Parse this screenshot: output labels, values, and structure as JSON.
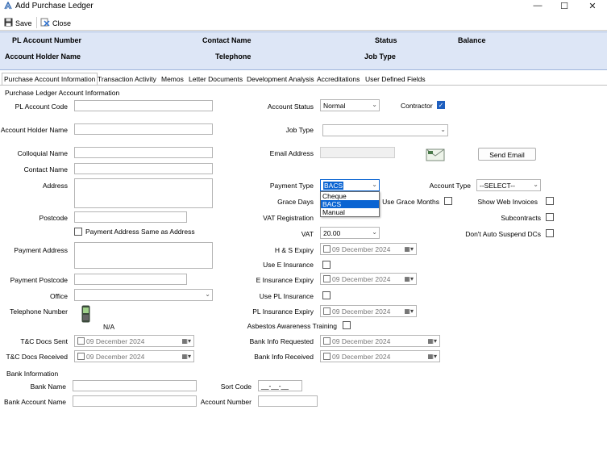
{
  "window": {
    "title": "Add Purchase Ledger",
    "controls": {
      "minimize": "—",
      "maximize": "☐",
      "close": "✕"
    }
  },
  "toolbar": {
    "save_label": "Save",
    "close_label": "Close"
  },
  "header": {
    "pl_account_number": "PL Account Number",
    "contact_name": "Contact Name",
    "status": "Status",
    "balance": "Balance",
    "account_holder_name": "Account Holder Name",
    "telephone": "Telephone",
    "job_type": "Job Type"
  },
  "tabs": [
    "Purchase Account Information",
    "Transaction Activity",
    "Memos",
    "Letter Documents",
    "Development Analysis",
    "Accreditations",
    "User Defined Fields"
  ],
  "section_title": "Purchase Ledger Account Information",
  "left": {
    "pl_account_code": "PL Account Code",
    "account_holder_name": "Account Holder Name",
    "colloquial_name": "Colloquial Name",
    "contact_name": "Contact Name",
    "address": "Address",
    "postcode": "Postcode",
    "payment_same_as_address": "Payment Address Same as Address",
    "payment_address": "Payment Address",
    "payment_postcode": "Payment Postcode",
    "office": "Office",
    "telephone_number": "Telephone Number",
    "telephone_value": "N/A",
    "tc_docs_sent": "T&C Docs Sent",
    "tc_docs_sent_value": "09 December 2024",
    "tc_docs_received": "T&C Docs Received",
    "tc_docs_received_value": "09 December 2024"
  },
  "middle": {
    "account_status": "Account Status",
    "account_status_value": "Normal",
    "job_type": "Job Type",
    "email_address": "Email Address",
    "payment_type": "Payment Type",
    "payment_type_value": "BACS",
    "payment_type_options": [
      "Cheque",
      "BACS",
      "Manual"
    ],
    "grace_days": "Grace Days",
    "vat_registration": "VAT Registration",
    "vat": "VAT",
    "vat_value": "20.00",
    "hs_expiry": "H & S Expiry",
    "hs_expiry_value": "09 December 2024",
    "use_e_insurance": "Use E Insurance",
    "e_insurance_expiry": "E Insurance Expiry",
    "e_insurance_expiry_value": "09 December 2024",
    "use_pl_insurance": "Use PL Insurance",
    "pl_insurance_expiry": "PL Insurance Expiry",
    "pl_insurance_expiry_value": "09 December 2024",
    "asbestos_training": "Asbestos Awareness Training",
    "bank_info_requested": "Bank Info Requested",
    "bank_info_requested_value": "09 December 2024",
    "bank_info_received": "Bank Info Received",
    "bank_info_received_value": "09 December 2024"
  },
  "right": {
    "contractor": "Contractor",
    "contractor_checked": true,
    "send_email": "Send Email",
    "account_type": "Account Type",
    "account_type_value": "--SELECT--",
    "use_grace_months": "Use Grace Months",
    "show_web_invoices": "Show Web Invoices",
    "subcontracts": "Subcontracts",
    "dont_auto_suspend": "Don't Auto Suspend DCs"
  },
  "bank": {
    "section": "Bank Information",
    "bank_name": "Bank Name",
    "sort_code": "Sort Code",
    "sort_code_mask": "__-__-__",
    "bank_account_name": "Bank Account Name",
    "account_number": "Account Number"
  },
  "icons": {
    "save": "floppy-disk-icon",
    "close": "close-document-icon",
    "email": "envelope-icon",
    "phone": "mobile-phone-icon",
    "app": "app-logo-icon"
  },
  "colors": {
    "header_band": "#dde6f6",
    "accent": "#1f5fbf",
    "highlight": "#0a64d2"
  }
}
